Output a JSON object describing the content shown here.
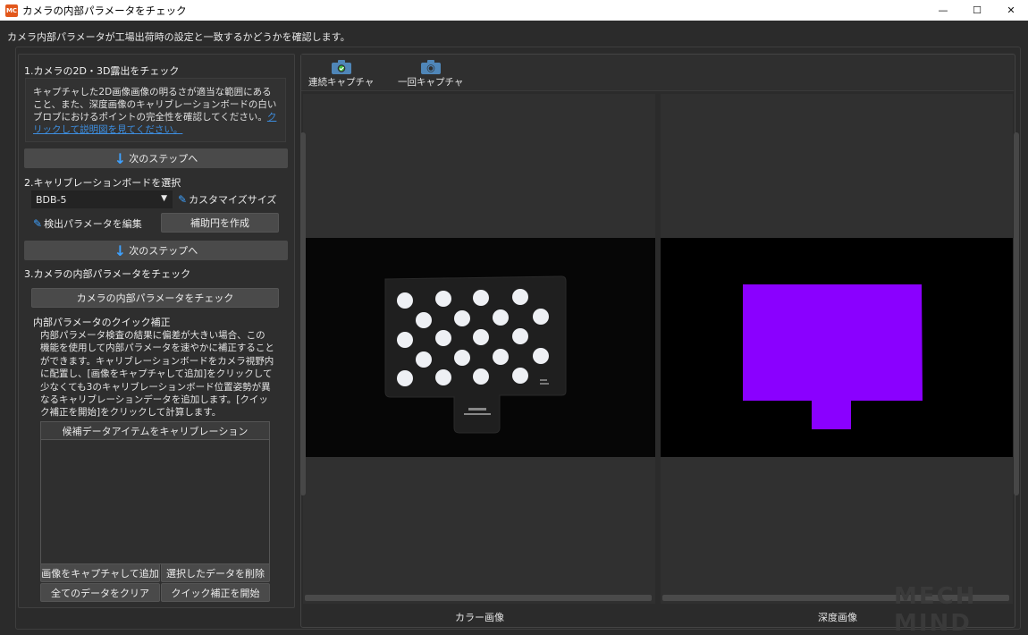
{
  "window": {
    "title": "カメラの内部パラメータをチェック",
    "logo_text": "MC",
    "controls": {
      "minimize": "—",
      "maximize": "☐",
      "close": "✕"
    }
  },
  "subtitle": "カメラ内部パラメータが工場出荷時の設定と一致するかどうかを確認します。",
  "step1": {
    "title": "1.カメラの2D・3D露出をチェック",
    "text": "キャプチャした2D画像画像の明るさが適当な範囲にあること、また、深度画像のキャリブレーションボードの白いブロブにおけるポイントの完全性を確認してください。",
    "link": "クリックして説明図を見てください。",
    "next_label": "次のステップへ"
  },
  "step2": {
    "title": "2.キャリブレーションボードを選択",
    "board_select": "BDB-5",
    "custom_size_label": "カスタマイズサイズ",
    "edit_params_label": "検出パラメータを編集",
    "aux_circle_label": "補助円を作成",
    "next_label": "次のステップへ"
  },
  "step3": {
    "title": "3.カメラの内部パラメータをチェック",
    "check_button": "カメラの内部パラメータをチェック",
    "quick_title": "内部パラメータのクイック補正",
    "quick_text": "内部パラメータ検査の結果に偏差が大きい場合、この機能を使用して内部パラメータを速やかに補正することができます。キャリブレーションボードをカメラ視野内に配置し、[画像をキャプチャして追加]をクリックして少なくても3のキャリブレーションボード位置姿勢が異なるキャリブレーションデータを追加します。[クイック補正を開始]をクリックして計算します。",
    "table_header": "候補データアイテムをキャリブレーション",
    "buttons": {
      "capture_add": "画像をキャプチャして追加",
      "delete_selected": "選択したデータを削除",
      "clear_all": "全てのデータをクリア",
      "start_quick": "クイック補正を開始"
    }
  },
  "toolbar": {
    "continuous_capture": "連続キャプチャ",
    "single_capture": "一回キャプチャ"
  },
  "views": {
    "color_label": "カラー画像",
    "depth_label": "深度画像"
  },
  "watermark": "MECH MIND",
  "colors": {
    "background": "#2b2b2b",
    "accent": "#3ea1ff",
    "depth_blob": "#8a00ff",
    "camera_icon": "#4f86b8"
  }
}
